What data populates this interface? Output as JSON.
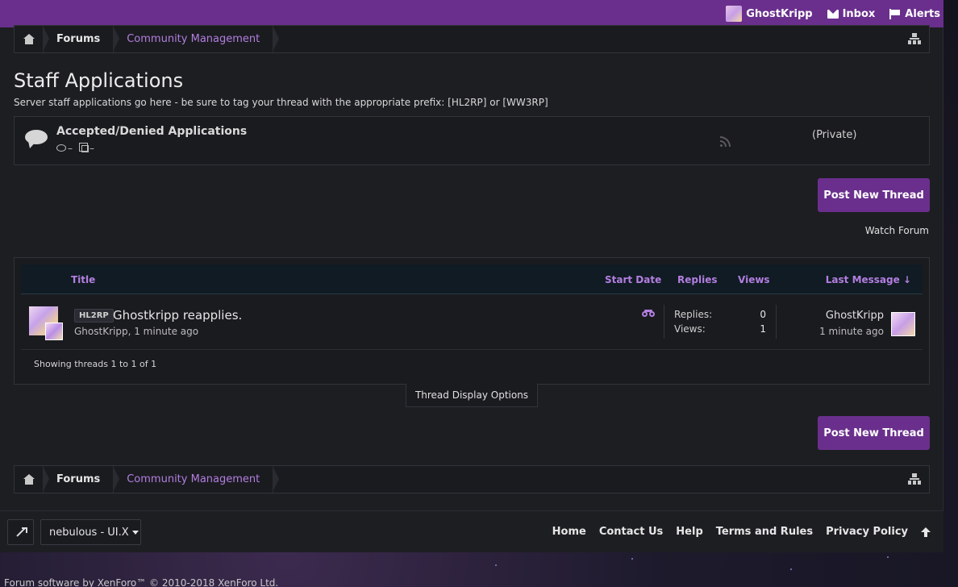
{
  "topbar": {
    "username": "GhostKripp",
    "inbox_label": "Inbox",
    "alerts_label": "Alerts"
  },
  "breadcrumb": {
    "items": [
      {
        "label": "Forums"
      },
      {
        "label": "Community Management"
      }
    ]
  },
  "page": {
    "title": "Staff Applications",
    "description": "Server staff applications go here - be sure to tag your thread with the appropriate prefix: [HL2RP] or [WW3RP]"
  },
  "subforum": {
    "title": "Accepted/Denied Applications",
    "discussions": "–",
    "messages": "–",
    "status": "(Private)"
  },
  "actions": {
    "post_new_thread": "Post New Thread",
    "watch_forum": "Watch Forum"
  },
  "thread_list": {
    "columns": {
      "title": "Title",
      "start_date": "Start Date",
      "replies": "Replies",
      "views": "Views",
      "last_message": "Last Message ↓"
    },
    "threads": [
      {
        "prefix": "HL2RP",
        "title": "Ghostkripp reapplies.",
        "author": "GhostKripp",
        "start_time": "1 minute ago",
        "replies_label": "Replies:",
        "replies": "0",
        "views_label": "Views:",
        "views": "1",
        "last_user": "GhostKripp",
        "last_time": "1 minute ago"
      }
    ],
    "showing": "Showing threads 1 to 1 of 1",
    "display_options": "Thread Display Options"
  },
  "footer": {
    "style_chooser": "nebulous - UI.X",
    "links": [
      "Home",
      "Contact Us",
      "Help",
      "Terms and Rules",
      "Privacy Policy"
    ],
    "copyright": "Forum software by XenForo™ © 2010-2018 XenForo Ltd."
  },
  "colors": {
    "accent": "#6a2f8d",
    "link": "#b37ee0",
    "panel": "#1a1b1f"
  }
}
